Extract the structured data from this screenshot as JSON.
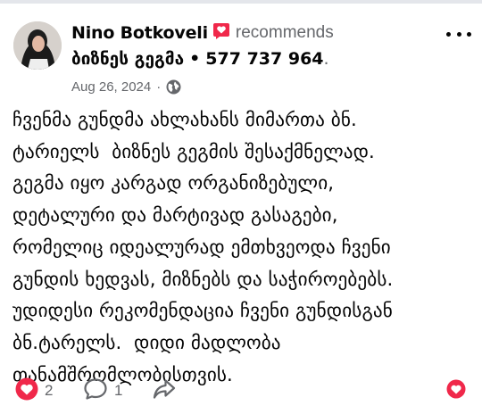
{
  "post": {
    "author": "Nino Botkoveli",
    "action": "recommends",
    "page_name": "ბიზნეს გეგმა",
    "separator": "•",
    "phone": "577 737 964",
    "period": ".",
    "date": "Aug 26, 2024",
    "date_separator": "·",
    "privacy_icon": "globe-icon",
    "body": "ჩვენმა გუნდმა ახლახანს მიმართა ბნ.\nტარიელს  ბიზნეს გეგმის შესაქმნელად.\nგეგმა იყო კარგად ორგანიზებული,\nდეტალური და მარტივად გასაგები,\nრომელიც იდეალურად ემთხვეოდა ჩვენი\nგუნდის ხედვას, მიზნებს და საჭიროებებს.\nუდიდესი რეკომენდაცია ჩვენი გუნდისგან\nბნ.ტარელს.  დიდი მადლობა\nთანამშრომლობისთვის."
  },
  "footer": {
    "reactions_count": "2",
    "comments_count": "1"
  },
  "colors": {
    "reaction_pink": "#f0284a",
    "secondary_text": "#65676b",
    "icon_gray": "#65676b"
  }
}
